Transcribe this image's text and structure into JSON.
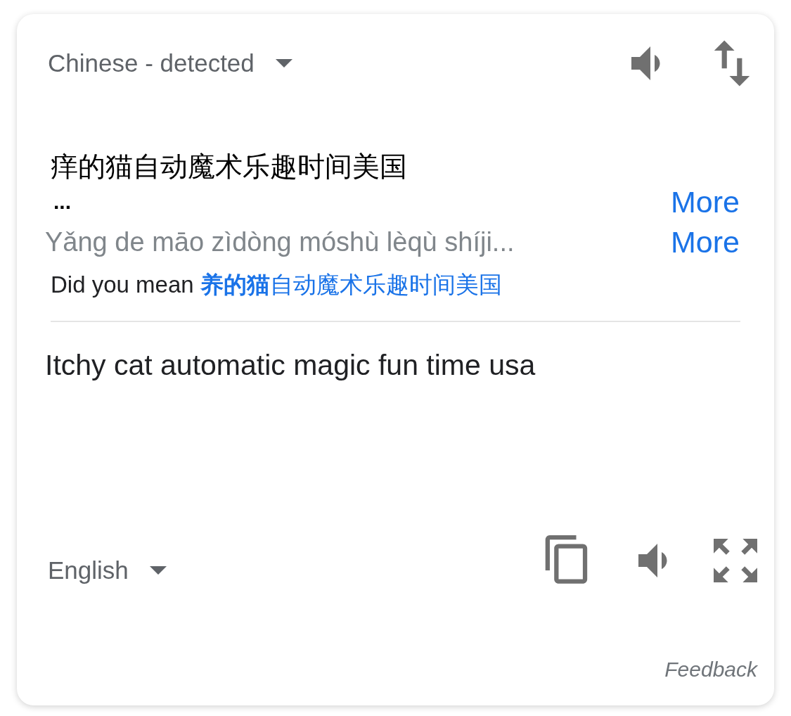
{
  "source": {
    "language": "Chinese - detected",
    "text": "痒的猫自动魔术乐趣时间美国",
    "ellipsis": "...",
    "more_text": "More",
    "romanization": "Yǎng de māo zìdòng móshù lèqù shíji...",
    "more_romanization": "More",
    "did_you_mean": {
      "label": "Did you mean",
      "suggestion": "**养的猫**自动魔术乐趣时间美国"
    }
  },
  "target": {
    "language": "English",
    "text": "Itchy cat automatic magic fun time usa"
  },
  "feedback": "Feedback"
}
